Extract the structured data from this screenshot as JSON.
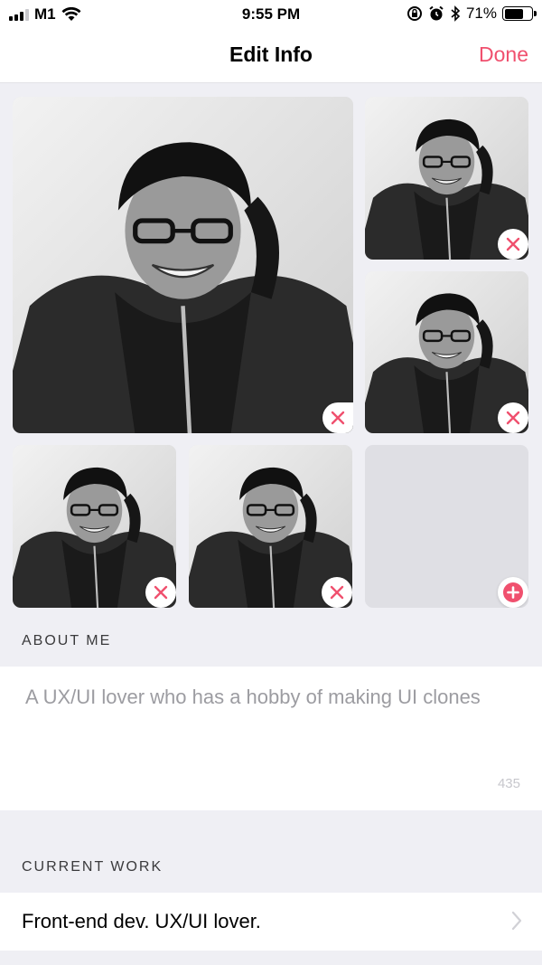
{
  "status_bar": {
    "carrier": "M1",
    "time": "9:55 PM",
    "battery_percent": "71%",
    "battery_level": 0.71
  },
  "nav": {
    "title": "Edit Info",
    "done_label": "Done"
  },
  "photos": {
    "remove_icon": "close-icon",
    "add_icon": "plus-icon",
    "slots_filled": 5,
    "slots_total": 6
  },
  "about": {
    "header": "ABOUT ME",
    "text": "A UX/UI lover who has a hobby of making UI clones",
    "remaining_chars": "435"
  },
  "work": {
    "header": "CURRENT WORK",
    "value": "Front-end dev. UX/UI lover."
  },
  "colors": {
    "accent": "#f0506e",
    "background": "#efeff4",
    "empty_slot": "#dfdfe4"
  }
}
